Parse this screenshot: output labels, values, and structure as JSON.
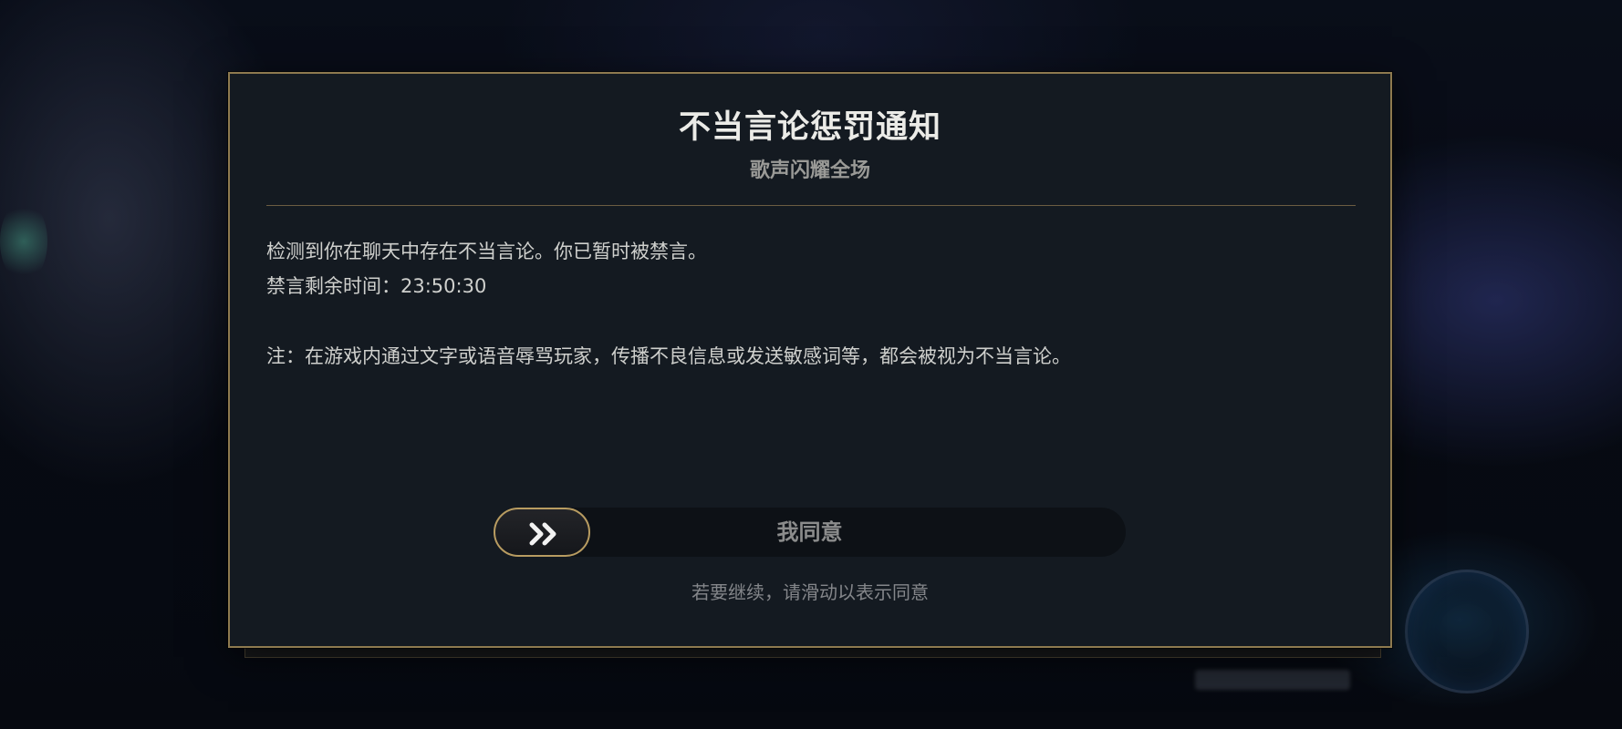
{
  "dialog": {
    "title": "不当言论惩罚通知",
    "subtitle": "歌声闪耀全场",
    "message_line_1": "检测到你在聊天中存在不当言论。你已暂时被禁言。",
    "message_line_2": "禁言剩余时间：23:50:30",
    "note": "注：在游戏内通过文字或语音辱骂玩家，传播不良信息或发送敏感词等，都会被视为不当言论。",
    "slider": {
      "label": "我同意",
      "handle_icon": "double-chevron-right-icon"
    },
    "hint": "若要继续，请滑动以表示同意"
  },
  "colors": {
    "accent_gold": "#b89c61",
    "border_gold": "#8e7a4f",
    "panel_bg": "#141a21"
  }
}
